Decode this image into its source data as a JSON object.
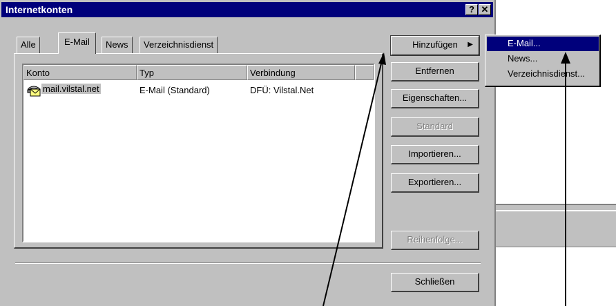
{
  "window": {
    "title": "Internetkonten",
    "help_glyph": "?",
    "close_glyph": "✕"
  },
  "tabs": [
    {
      "label": "Alle"
    },
    {
      "label": "E-Mail",
      "active": true
    },
    {
      "label": "News"
    },
    {
      "label": "Verzeichnisdienst"
    }
  ],
  "list": {
    "columns": [
      "Konto",
      "Typ",
      "Verbindung"
    ],
    "rows": [
      {
        "konto": "mail.vilstal.net",
        "typ": "E-Mail (Standard)",
        "verbindung": "DFÜ: Vilstal.Net"
      }
    ]
  },
  "buttons": {
    "add": "Hinzufügen",
    "add_arrow": "▶",
    "remove": "Entfernen",
    "properties": "Eigenschaften...",
    "default": "Standard",
    "import": "Importieren...",
    "export": "Exportieren...",
    "order": "Reihenfolge...",
    "close": "Schließen"
  },
  "menu": {
    "items": [
      "E-Mail...",
      "News...",
      "Verzeichnisdienst..."
    ]
  },
  "colors": {
    "titlebar": "#00007b",
    "face": "#c0c0c0",
    "highlight": "#00007b"
  }
}
